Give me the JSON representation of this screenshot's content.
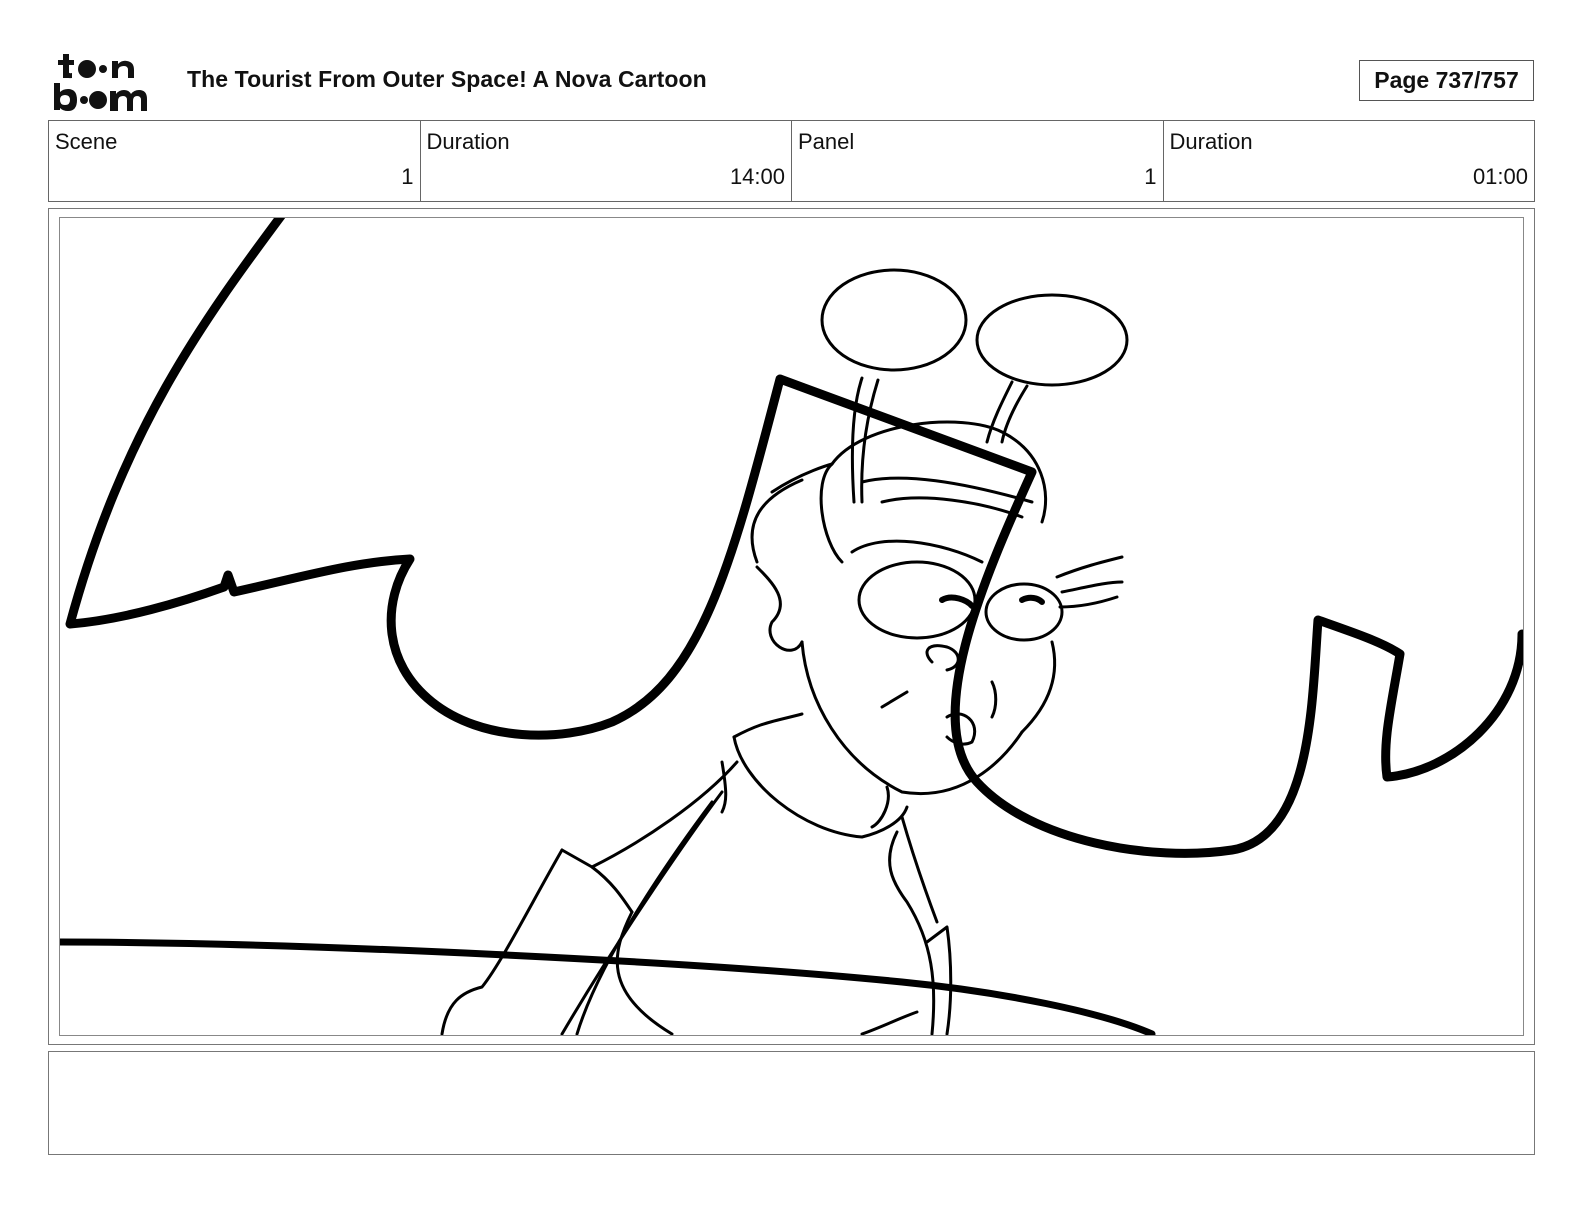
{
  "header": {
    "logo_text": "toon boom",
    "title": "The Tourist From Outer Space!  A Nova Cartoon",
    "page_label": "Page 737/757"
  },
  "info": {
    "scene_label": "Scene",
    "scene_value": "1",
    "scene_duration_label": "Duration",
    "scene_duration_value": "14:00",
    "panel_label": "Panel",
    "panel_value": "1",
    "panel_duration_label": "Duration",
    "panel_duration_value": "01:00"
  },
  "panel": {
    "drawing": "storyboard-sketch"
  },
  "notes": {
    "text": ""
  }
}
